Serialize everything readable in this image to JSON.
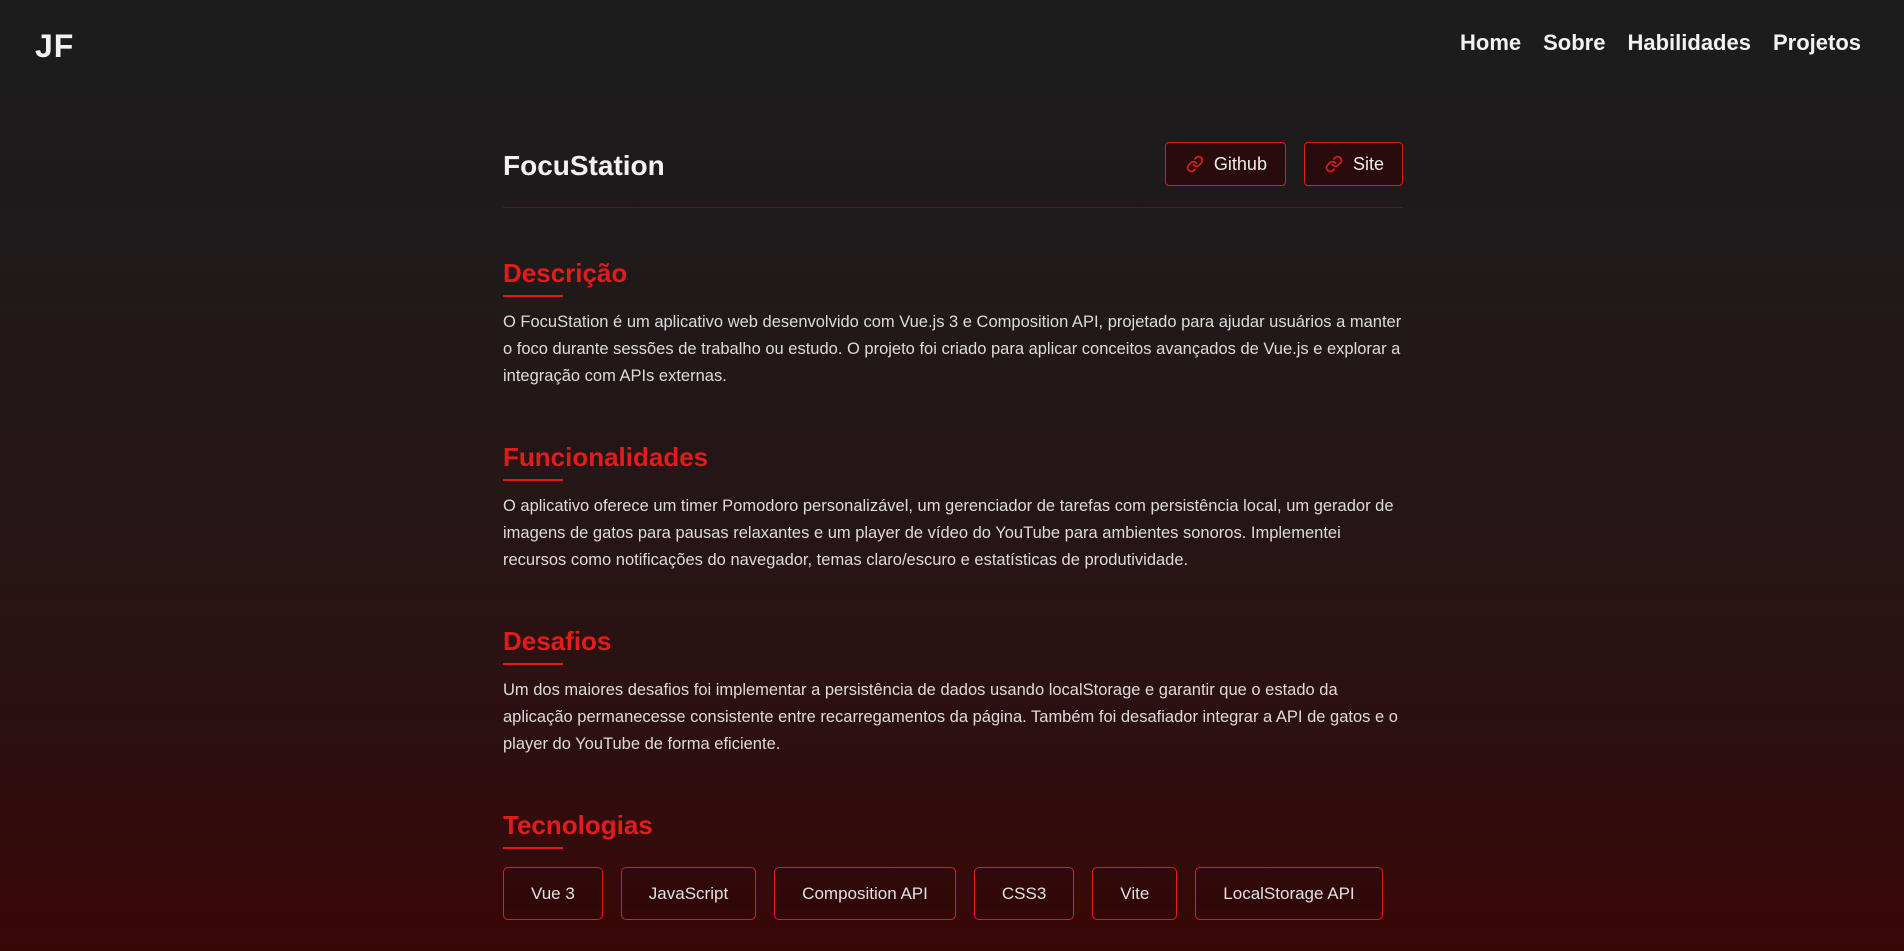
{
  "header": {
    "logo": "JF",
    "nav": [
      "Home",
      "Sobre",
      "Habilidades",
      "Projetos"
    ]
  },
  "project": {
    "title": "FocuStation",
    "links": [
      {
        "label": "Github",
        "icon": "link-icon"
      },
      {
        "label": "Site",
        "icon": "link-icon"
      }
    ]
  },
  "sections": {
    "descricao": {
      "heading": "Descrição",
      "text": "O FocuStation é um aplicativo web desenvolvido com Vue.js 3 e Composition API, projetado para ajudar usuários a manter o foco durante sessões de trabalho ou estudo. O projeto foi criado para aplicar conceitos avançados de Vue.js e explorar a integração com APIs externas."
    },
    "funcionalidades": {
      "heading": "Funcionalidades",
      "text": "O aplicativo oferece um timer Pomodoro personalizável, um gerenciador de tarefas com persistência local, um gerador de imagens de gatos para pausas relaxantes e um player de vídeo do YouTube para ambientes sonoros. Implementei recursos como notificações do navegador, temas claro/escuro e estatísticas de produtividade."
    },
    "desafios": {
      "heading": "Desafios",
      "text": "Um dos maiores desafios foi implementar a persistência de dados usando localStorage e garantir que o estado da aplicação permanecesse consistente entre recarregamentos da página. Também foi desafiador integrar a API de gatos e o player do YouTube de forma eficiente."
    },
    "tecnologias": {
      "heading": "Tecnologias",
      "tags": [
        "Vue 3",
        "JavaScript",
        "Composition API",
        "CSS3",
        "Vite",
        "LocalStorage API"
      ]
    }
  },
  "colors": {
    "accent": "#e31b1b",
    "header_bg": "#1c1c1c"
  }
}
